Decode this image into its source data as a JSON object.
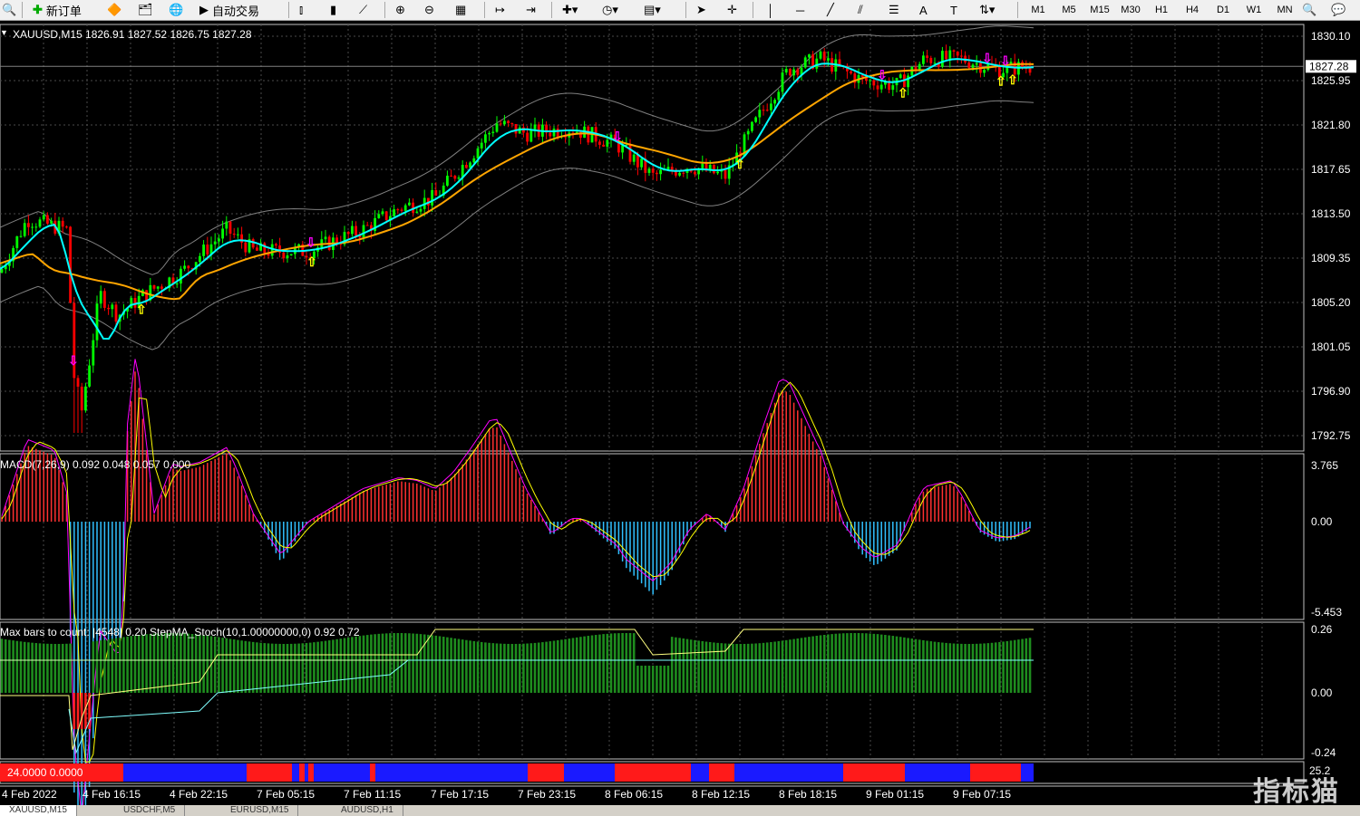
{
  "toolbar": {
    "new_order": "新订单",
    "auto_trade": "自动交易",
    "timeframes": [
      "M1",
      "M5",
      "M15",
      "M30",
      "H1",
      "H4",
      "D1",
      "W1",
      "MN"
    ]
  },
  "main_chart": {
    "header": "XAUUSD,M15  1826.91 1827.52 1826.75 1827.28",
    "current_price": "1827.28",
    "y_labels": [
      "1830.10",
      "1825.95",
      "1821.80",
      "1817.65",
      "1813.50",
      "1809.35",
      "1805.20",
      "1801.05",
      "1796.90",
      "1792.75"
    ]
  },
  "macd_panel": {
    "header": "MACD(7,26,9) 0.092 0.048 0.057 0.000",
    "y_labels": [
      "3.765",
      "0.00",
      "-5.453"
    ]
  },
  "stoch_panel": {
    "header": "Max bars to count: |4548|   0.20   StepMA_Stoch(10,1.00000000,0) 0.92 0.72",
    "y_labels": [
      "0.26",
      "0.00",
      "-0.24"
    ]
  },
  "bar_panel": {
    "header": "24.0000 0.0000",
    "y_label": "25.2",
    "colors": {
      "red": "#ff1a1a",
      "blue": "#1a1aff"
    }
  },
  "x_labels": [
    "4 Feb 2022",
    "4 Feb 16:15",
    "4 Feb 22:15",
    "7 Feb 05:15",
    "7 Feb 11:15",
    "7 Feb 17:15",
    "7 Feb 23:15",
    "8 Feb 06:15",
    "8 Feb 12:15",
    "8 Feb 18:15",
    "9 Feb 01:15",
    "9 Feb 07:15"
  ],
  "tabs": [
    "XAUUSD,M15",
    "USDCHF,M5",
    "EURUSD,M15",
    "AUDUSD,H1"
  ],
  "watermark": "指标猫",
  "colors": {
    "up": "#00ff00",
    "down": "#ff0000",
    "fast_ma": "#00ffff",
    "slow_ma": "#ffa500",
    "bands": "#808080",
    "macd_signal": "#ff00ff",
    "macd_line": "#ffff00"
  }
}
